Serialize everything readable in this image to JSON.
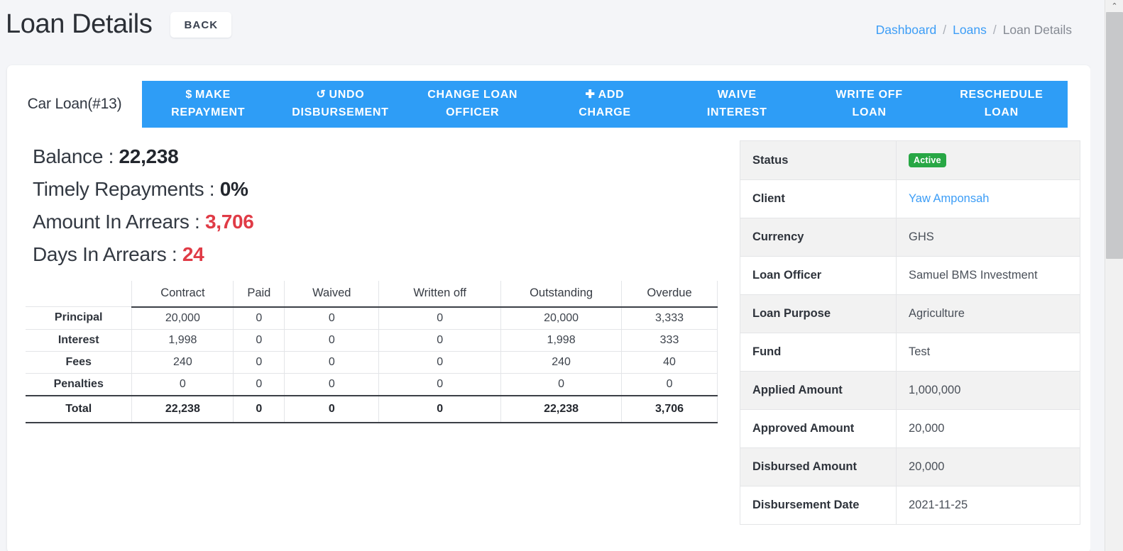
{
  "header": {
    "title": "Loan Details",
    "back_label": "BACK",
    "breadcrumb": {
      "items": [
        {
          "label": "Dashboard",
          "link": true
        },
        {
          "label": "Loans",
          "link": true
        },
        {
          "label": "Loan Details",
          "link": false
        }
      ],
      "separator": "/"
    }
  },
  "loan": {
    "name": "Car Loan(#13)"
  },
  "actions": [
    {
      "icon": "$",
      "icon_name": "dollar-icon",
      "line1": "MAKE",
      "line2": "REPAYMENT"
    },
    {
      "icon": "↺",
      "icon_name": "undo-icon",
      "line1": "UNDO",
      "line2": "DISBURSEMENT"
    },
    {
      "icon": "",
      "icon_name": "",
      "line1": "CHANGE LOAN",
      "line2": "OFFICER"
    },
    {
      "icon": "✚",
      "icon_name": "plus-icon",
      "line1": "ADD",
      "line2": "CHARGE"
    },
    {
      "icon": "",
      "icon_name": "",
      "line1": "WAIVE",
      "line2": "INTEREST"
    },
    {
      "icon": "",
      "icon_name": "",
      "line1": "WRITE OFF",
      "line2": "LOAN"
    },
    {
      "icon": "",
      "icon_name": "",
      "line1": "RESCHEDULE",
      "line2": "LOAN"
    }
  ],
  "summary": [
    {
      "label": "Balance :",
      "value": "22,238",
      "danger": false
    },
    {
      "label": "Timely Repayments :",
      "value": "0%",
      "danger": false
    },
    {
      "label": "Amount In Arrears :",
      "value": "3,706",
      "danger": true
    },
    {
      "label": "Days In Arrears :",
      "value": "24",
      "danger": true
    }
  ],
  "amounts_table": {
    "columns": [
      "",
      "Contract",
      "Paid",
      "Waived",
      "Written off",
      "Outstanding",
      "Overdue"
    ],
    "rows": [
      {
        "label": "Principal",
        "values": [
          "20,000",
          "0",
          "0",
          "0",
          "20,000",
          "3,333"
        ]
      },
      {
        "label": "Interest",
        "values": [
          "1,998",
          "0",
          "0",
          "0",
          "1,998",
          "333"
        ]
      },
      {
        "label": "Fees",
        "values": [
          "240",
          "0",
          "0",
          "0",
          "240",
          "40"
        ]
      },
      {
        "label": "Penalties",
        "values": [
          "0",
          "0",
          "0",
          "0",
          "0",
          "0"
        ]
      }
    ],
    "total": {
      "label": "Total",
      "values": [
        "22,238",
        "0",
        "0",
        "0",
        "22,238",
        "3,706"
      ]
    }
  },
  "details": [
    {
      "key": "Status",
      "value": "Active",
      "type": "badge"
    },
    {
      "key": "Client",
      "value": "Yaw Amponsah",
      "type": "link"
    },
    {
      "key": "Currency",
      "value": "GHS",
      "type": "text"
    },
    {
      "key": "Loan Officer",
      "value": "Samuel BMS Investment",
      "type": "text"
    },
    {
      "key": "Loan Purpose",
      "value": "Agriculture",
      "type": "text"
    },
    {
      "key": "Fund",
      "value": "Test",
      "type": "text"
    },
    {
      "key": "Applied Amount",
      "value": "1,000,000",
      "type": "text"
    },
    {
      "key": "Approved Amount",
      "value": "20,000",
      "type": "text"
    },
    {
      "key": "Disbursed Amount",
      "value": "20,000",
      "type": "text"
    },
    {
      "key": "Disbursement Date",
      "value": "2021-11-25",
      "type": "text"
    }
  ],
  "colors": {
    "accent_blue": "#2e9df6",
    "link_blue": "#3c9df6",
    "danger_red": "#e03b46",
    "status_green": "#28a745",
    "page_bg": "#f4f5f8"
  },
  "scrollbar": {
    "up_arrow": "⌃"
  }
}
